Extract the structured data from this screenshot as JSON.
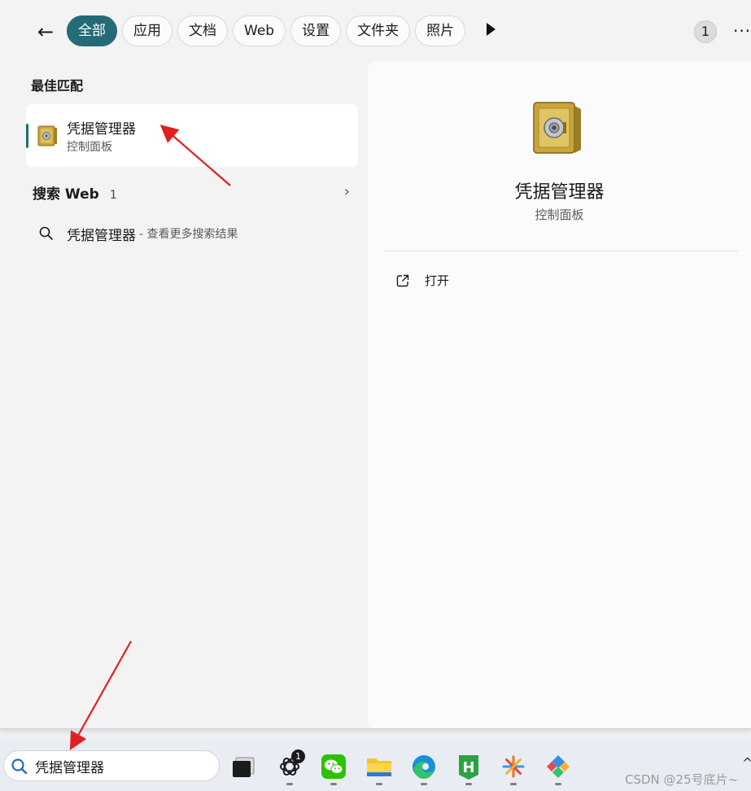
{
  "filters": {
    "back_label": "←",
    "chips": [
      {
        "label": "全部",
        "active": true
      },
      {
        "label": "应用",
        "active": false
      },
      {
        "label": "文档",
        "active": false
      },
      {
        "label": "Web",
        "active": false
      },
      {
        "label": "设置",
        "active": false
      },
      {
        "label": "文件夹",
        "active": false
      },
      {
        "label": "照片",
        "active": false
      }
    ],
    "badge_count": "1",
    "more_label": "···"
  },
  "results": {
    "best_match_title": "最佳匹配",
    "best_match": {
      "name": "凭据管理器",
      "type": "控制面板",
      "icon": "credential-manager-safe-icon"
    },
    "web_title": "搜索 Web",
    "web_count": "1",
    "web_result": {
      "query": "凭据管理器",
      "hint": "- 查看更多搜索结果"
    }
  },
  "preview": {
    "name": "凭据管理器",
    "type": "控制面板",
    "open_label": "打开"
  },
  "taskbar": {
    "search_text": "凭据管理器",
    "apps": [
      {
        "name": "task-view",
        "icon": "task-view-icon"
      },
      {
        "name": "chatgpt",
        "icon": "openai-icon",
        "badge": "1"
      },
      {
        "name": "wechat",
        "icon": "wechat-icon"
      },
      {
        "name": "file-explorer",
        "icon": "folder-icon"
      },
      {
        "name": "edge",
        "icon": "edge-icon"
      },
      {
        "name": "hbuilder",
        "icon": "hbuilder-icon"
      },
      {
        "name": "asterisk-app",
        "icon": "sparkle-icon"
      },
      {
        "name": "diamond-app",
        "icon": "diamond-icon"
      }
    ],
    "watermark": "CSDN @25号底片~",
    "tray_arrow": "^"
  },
  "colors": {
    "accent": "#246b75",
    "annotation_arrow": "#e02020"
  }
}
